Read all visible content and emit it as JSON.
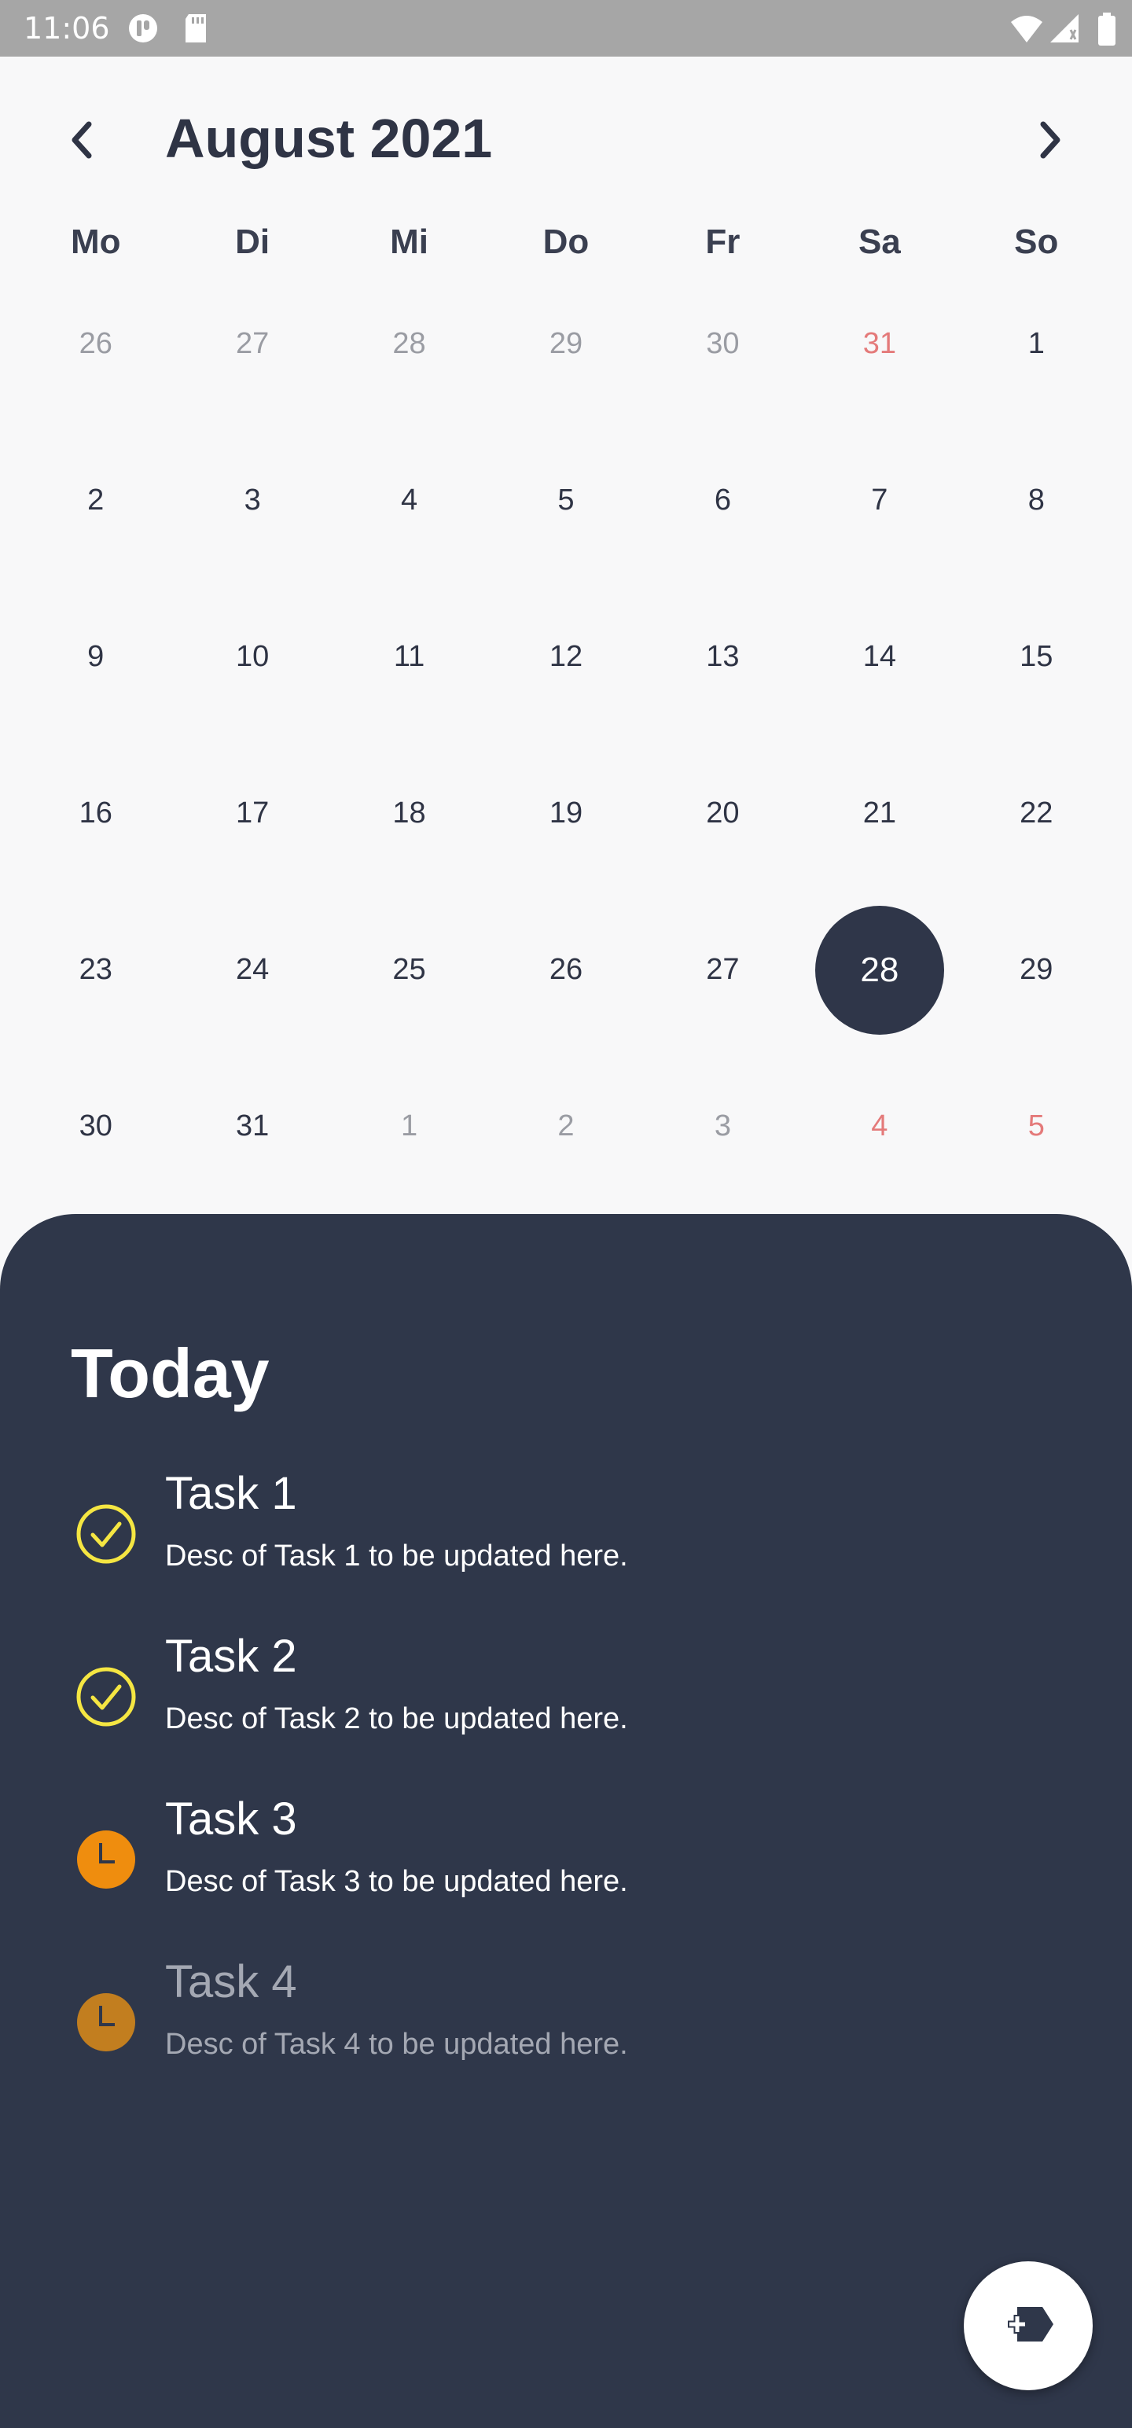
{
  "status_bar": {
    "time": "11:06",
    "left_icons": [
      "toggle-off-icon",
      "sd-card-icon"
    ],
    "right_icons": [
      "wifi-icon",
      "signal-icon",
      "battery-icon"
    ]
  },
  "calendar": {
    "month_label": "August 2021",
    "prev_icon": "chevron-left-icon",
    "next_icon": "chevron-right-icon",
    "weekdays": [
      "Mo",
      "Di",
      "Mi",
      "Do",
      "Fr",
      "Sa",
      "So"
    ],
    "days": [
      {
        "label": "26",
        "state": "other"
      },
      {
        "label": "27",
        "state": "other"
      },
      {
        "label": "28",
        "state": "other"
      },
      {
        "label": "29",
        "state": "other"
      },
      {
        "label": "30",
        "state": "other"
      },
      {
        "label": "31",
        "state": "other-weekend"
      },
      {
        "label": "1",
        "state": "normal"
      },
      {
        "label": "2",
        "state": "normal"
      },
      {
        "label": "3",
        "state": "normal"
      },
      {
        "label": "4",
        "state": "normal"
      },
      {
        "label": "5",
        "state": "normal"
      },
      {
        "label": "6",
        "state": "normal"
      },
      {
        "label": "7",
        "state": "normal"
      },
      {
        "label": "8",
        "state": "normal"
      },
      {
        "label": "9",
        "state": "normal"
      },
      {
        "label": "10",
        "state": "normal"
      },
      {
        "label": "11",
        "state": "normal"
      },
      {
        "label": "12",
        "state": "normal"
      },
      {
        "label": "13",
        "state": "normal"
      },
      {
        "label": "14",
        "state": "normal"
      },
      {
        "label": "15",
        "state": "normal"
      },
      {
        "label": "16",
        "state": "normal"
      },
      {
        "label": "17",
        "state": "normal"
      },
      {
        "label": "18",
        "state": "normal"
      },
      {
        "label": "19",
        "state": "normal"
      },
      {
        "label": "20",
        "state": "normal"
      },
      {
        "label": "21",
        "state": "normal"
      },
      {
        "label": "22",
        "state": "normal"
      },
      {
        "label": "23",
        "state": "normal"
      },
      {
        "label": "24",
        "state": "normal"
      },
      {
        "label": "25",
        "state": "normal"
      },
      {
        "label": "26",
        "state": "normal"
      },
      {
        "label": "27",
        "state": "normal"
      },
      {
        "label": "28",
        "state": "selected"
      },
      {
        "label": "29",
        "state": "normal"
      },
      {
        "label": "30",
        "state": "normal"
      },
      {
        "label": "31",
        "state": "normal"
      },
      {
        "label": "1",
        "state": "other"
      },
      {
        "label": "2",
        "state": "other"
      },
      {
        "label": "3",
        "state": "other"
      },
      {
        "label": "4",
        "state": "other-weekend"
      },
      {
        "label": "5",
        "state": "other-weekend"
      }
    ]
  },
  "today": {
    "title": "Today",
    "tasks": [
      {
        "title": "Task 1",
        "desc": "Desc of Task 1 to be updated here.",
        "status": "done",
        "icon": "check-circle-icon"
      },
      {
        "title": "Task 2",
        "desc": "Desc of Task 2 to be updated here.",
        "status": "done",
        "icon": "check-circle-icon"
      },
      {
        "title": "Task 3",
        "desc": "Desc of Task 3 to be updated here.",
        "status": "pending",
        "icon": "clock-icon"
      },
      {
        "title": "Task 4",
        "desc": "Desc of Task 4 to be updated here.",
        "status": "pending-dim",
        "icon": "clock-icon"
      }
    ]
  },
  "fab": {
    "icon": "add-task-icon"
  },
  "colors": {
    "accent_dark": "#2f3649",
    "panel_bg": "#2f374a",
    "check_yellow": "#f5e642",
    "clock_orange": "#ef8d0e",
    "weekend_red": "#e47a7a"
  }
}
